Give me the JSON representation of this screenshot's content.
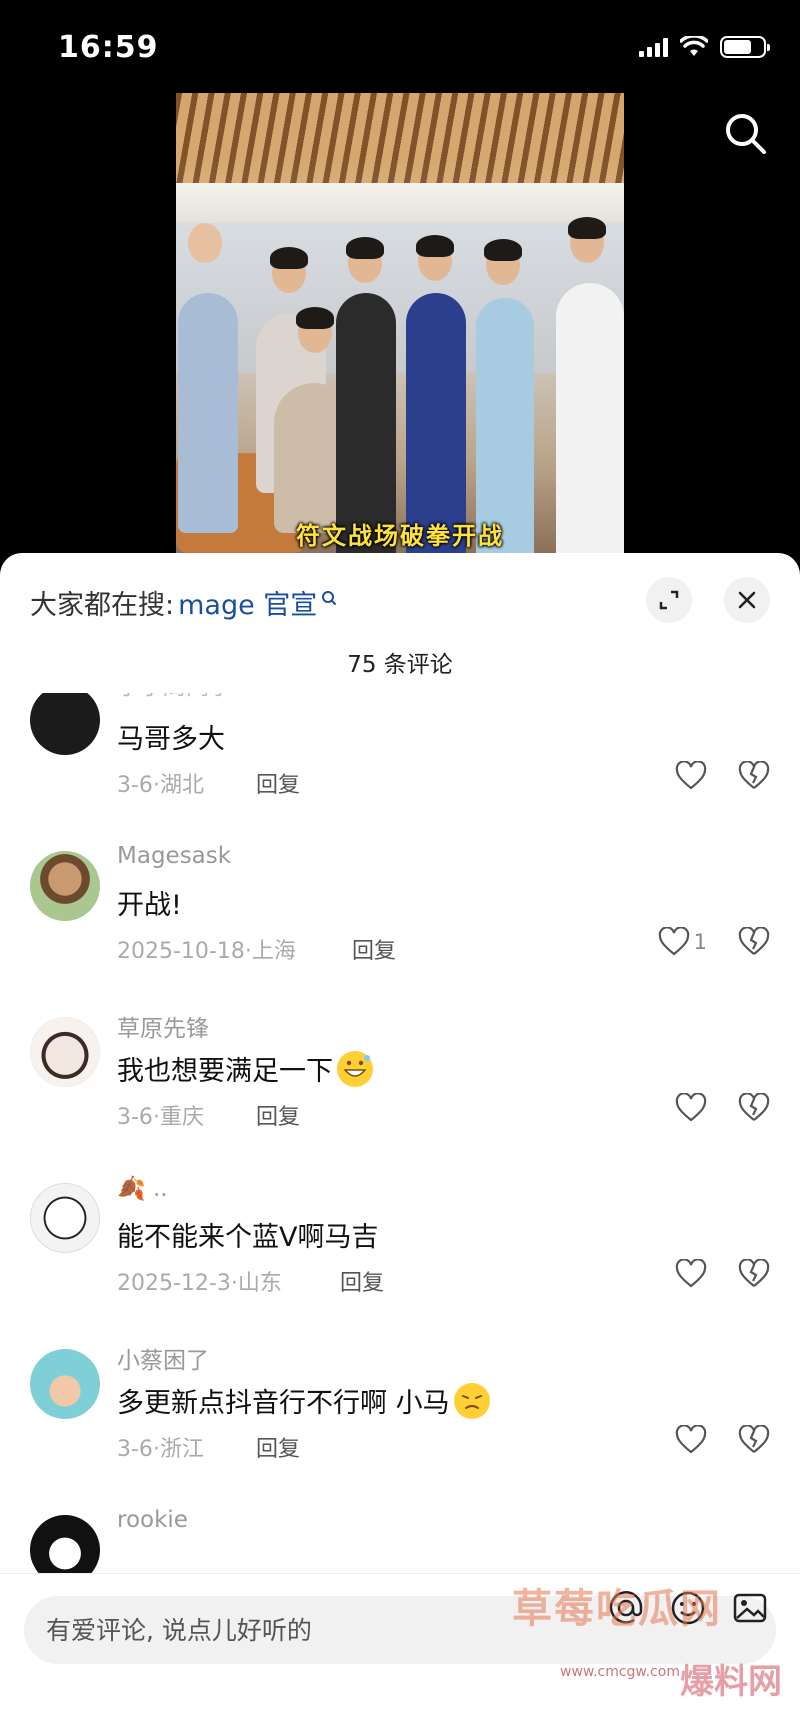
{
  "status_bar": {
    "time": "16:59"
  },
  "video": {
    "caption": "符文战场破拳开战"
  },
  "sheet": {
    "trending_prefix": "大家都在搜:",
    "trending_keyword": "mage 官宣",
    "comment_count": "75 条评论"
  },
  "comments": [
    {
      "username": "小小周同学",
      "text": "马哥多大",
      "date": "3-6",
      "location": "湖北",
      "reply": "回复",
      "likes": ""
    },
    {
      "username": "Magesask",
      "text": "开战!",
      "date": "2025-10-18",
      "location": "上海",
      "reply": "回复",
      "likes": "1"
    },
    {
      "username": "草原先锋",
      "text": "我也想要满足一下",
      "date": "3-6",
      "location": "重庆",
      "reply": "回复",
      "likes": ""
    },
    {
      "username": "🍂 ..",
      "text": "能不能来个蓝V啊马吉",
      "date": "2025-12-3",
      "location": "山东",
      "reply": "回复",
      "likes": ""
    },
    {
      "username": "小蔡困了",
      "text": "多更新点抖音行不行啊 小马",
      "date": "3-6",
      "location": "浙江",
      "reply": "回复",
      "likes": ""
    },
    {
      "username": "rookie",
      "text": "",
      "date": "",
      "location": "",
      "reply": "",
      "likes": ""
    }
  ],
  "meta_separator": "·",
  "input": {
    "placeholder": "有爱评论, 说点儿好听的"
  },
  "watermark": {
    "main": "草莓吃瓜网",
    "url": "www.cmcgw.com",
    "side": "爆料网"
  },
  "icons": {
    "search": "search-icon",
    "expand": "expand-icon",
    "close": "close-icon",
    "like": "heart-icon",
    "dislike": "broken-heart-icon",
    "at": "at-icon",
    "emoji": "emoji-icon",
    "image": "image-icon"
  },
  "colors": {
    "accent_keyword": "#1a4f9c",
    "sheet_bg": "#ffffff",
    "input_bg": "#f1f1f1"
  }
}
